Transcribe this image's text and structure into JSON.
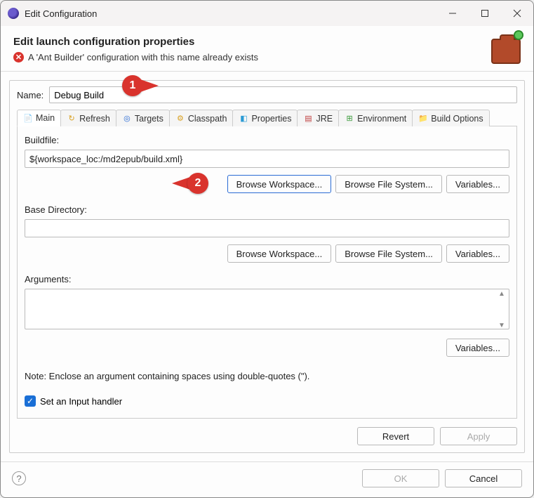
{
  "window": {
    "title": "Edit Configuration"
  },
  "header": {
    "title": "Edit launch configuration properties",
    "error": "A 'Ant Builder' configuration with this name already exists"
  },
  "name": {
    "label": "Name:",
    "value": "Debug Build"
  },
  "tabs": [
    {
      "label": "Main"
    },
    {
      "label": "Refresh"
    },
    {
      "label": "Targets"
    },
    {
      "label": "Classpath"
    },
    {
      "label": "Properties"
    },
    {
      "label": "JRE"
    },
    {
      "label": "Environment"
    },
    {
      "label": "Build Options"
    }
  ],
  "main": {
    "buildfile_label": "Buildfile:",
    "buildfile_value": "${workspace_loc:/md2epub/build.xml}",
    "basedir_label": "Base Directory:",
    "basedir_value": "",
    "arguments_label": "Arguments:",
    "arguments_value": "",
    "note": "Note: Enclose an argument containing spaces using double-quotes (\").",
    "input_handler_label": "Set an Input handler",
    "btn_browse_workspace": "Browse Workspace...",
    "btn_browse_filesystem": "Browse File System...",
    "btn_variables": "Variables..."
  },
  "buttons": {
    "revert": "Revert",
    "apply": "Apply",
    "ok": "OK",
    "cancel": "Cancel"
  },
  "callouts": {
    "one": "1",
    "two": "2"
  }
}
